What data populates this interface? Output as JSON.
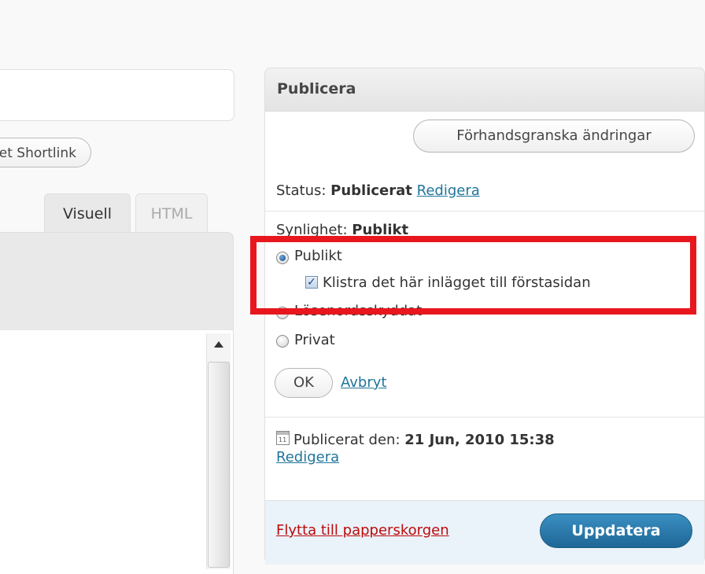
{
  "editor": {
    "shortlink_label": "Get Shortlink",
    "tabs": [
      "Visuell",
      "HTML"
    ]
  },
  "publish": {
    "title": "Publicera",
    "preview_button": "Förhandsgranska ändringar",
    "status_label": "Status:",
    "status_value": "Publicerat",
    "status_edit": "Redigera",
    "visibility_label": "Synlighet:",
    "visibility_value": "Publikt",
    "options": [
      "Publikt",
      "Lösenordsskyddat",
      "Privat"
    ],
    "selected_option": "Publikt",
    "sticky_label": "Klistra det här inlägget till förstasidan",
    "sticky_checked": true,
    "ok_button": "OK",
    "cancel_link": "Avbryt",
    "published_on_label": "Publicerat den:",
    "published_on_value": "21 Jun, 2010 15:38",
    "date_edit": "Redigera",
    "trash_link": "Flytta till papperskorgen",
    "update_button": "Uppdatera",
    "calendar_day": "11"
  },
  "colors": {
    "link": "#21759b",
    "trash": "#bc0b0b",
    "update_button": "#21759b",
    "highlight": "#e8171e"
  }
}
